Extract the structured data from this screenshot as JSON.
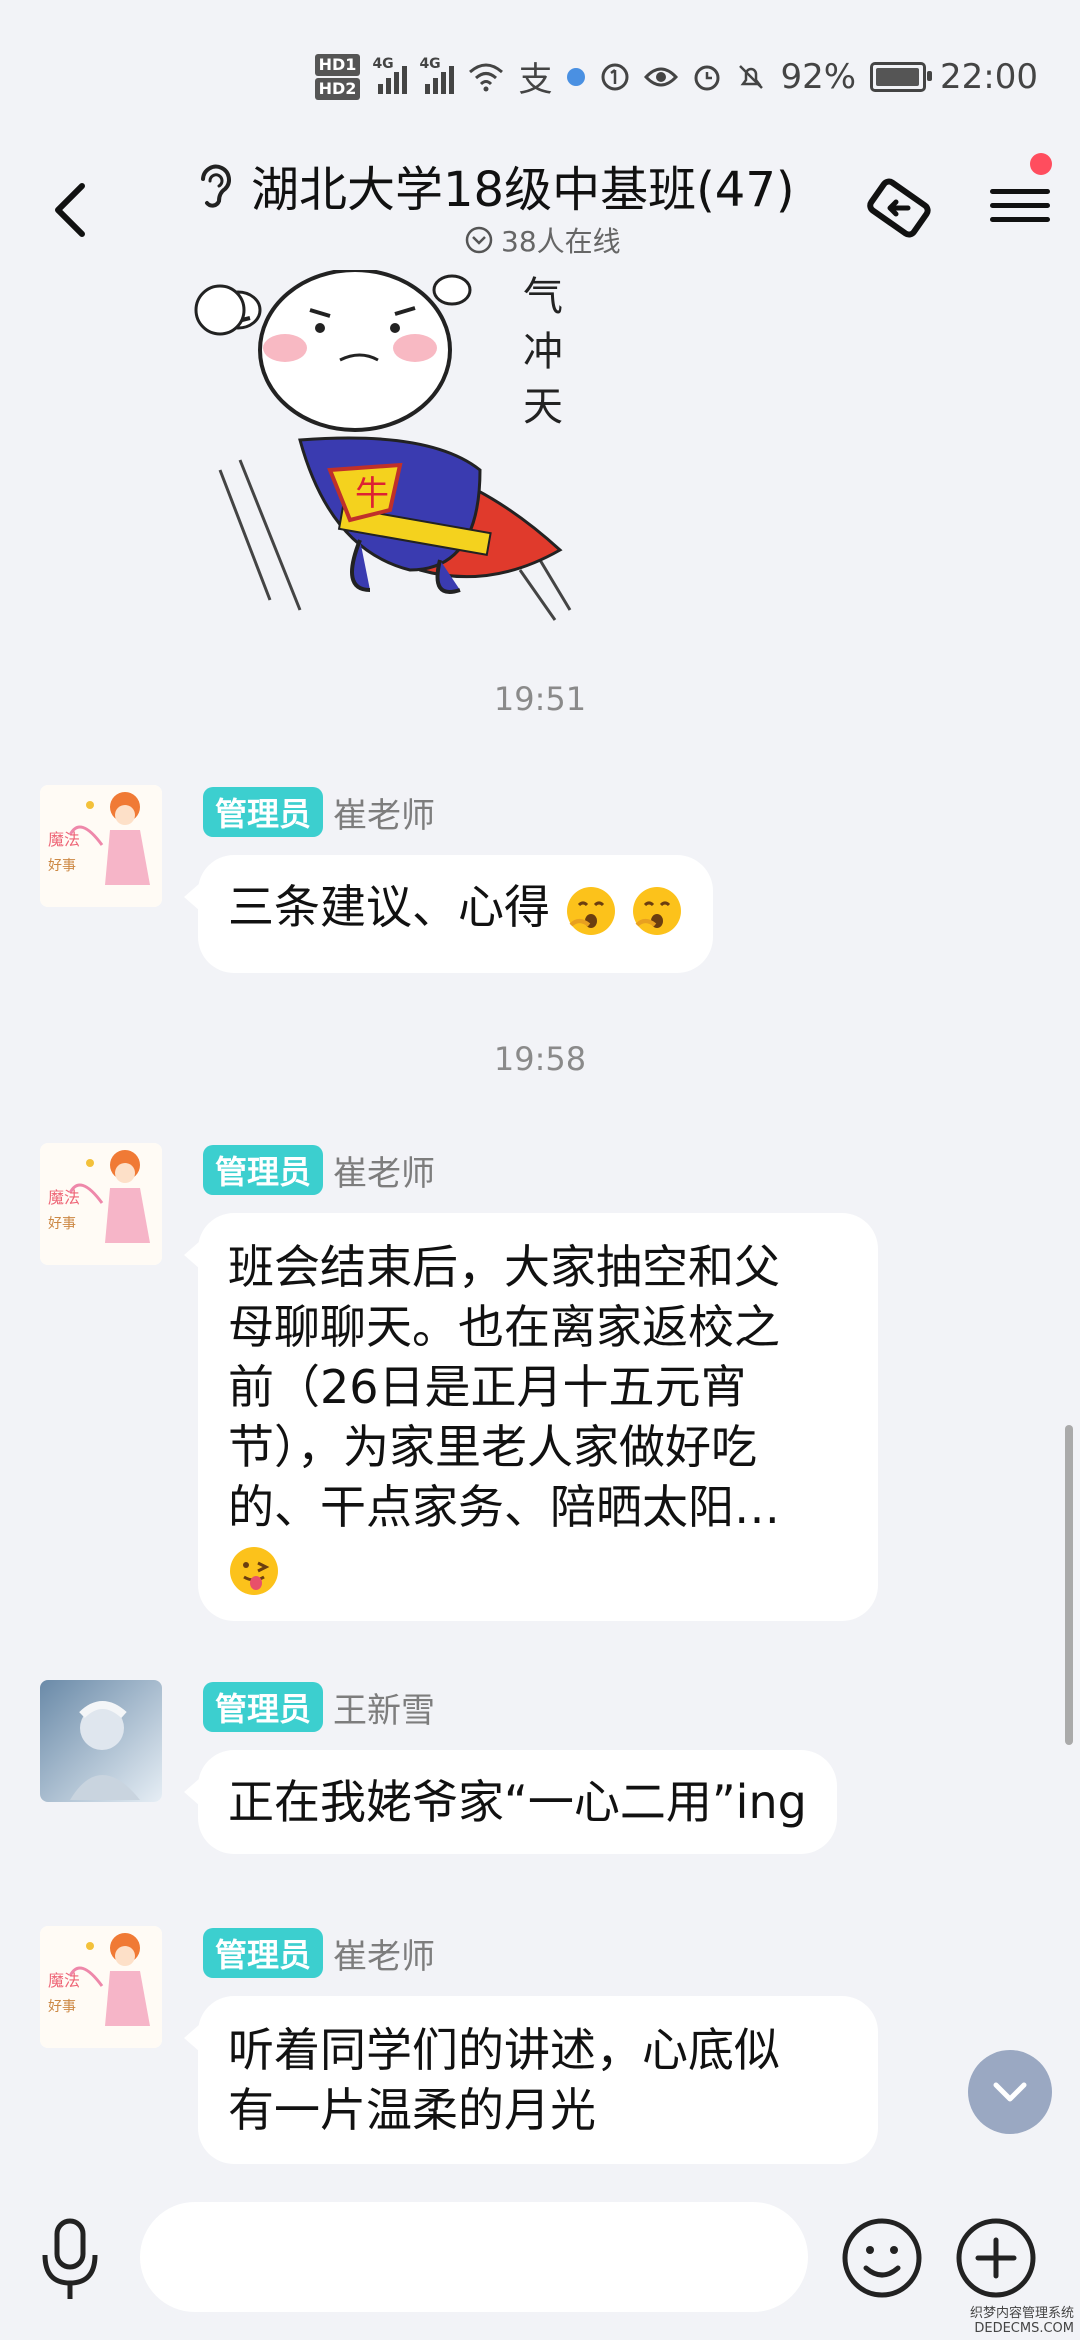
{
  "status_bar": {
    "sim1": "HD1",
    "sim2": "HD2",
    "net1": "4G",
    "net2": "4G",
    "pay": "支",
    "battery": "92%",
    "time": "22:00"
  },
  "header": {
    "title": "湖北大学18级中基班(47)",
    "online": "38人在线",
    "ear_icon": "ear-icon",
    "share_icon": "share-icon",
    "menu_icon": "menu-icon"
  },
  "sticker": {
    "texts": [
      "气",
      "冲",
      "天"
    ],
    "badge": "牛"
  },
  "messages": [
    {
      "time": "19:51",
      "badge": "管理员",
      "sender": "崔老师",
      "text": "三条建议、心得"
    },
    {
      "time": "19:58",
      "badge": "管理员",
      "sender": "崔老师",
      "lines": [
        "班会结束后，大家抽空和父",
        "母聊聊天。也在离家返校之",
        "前（26日是正月十五元宵",
        "节），为家里老人家做好吃",
        "的、干点家务、陪晒太阳…"
      ]
    },
    {
      "badge": "管理员",
      "sender": "王新雪",
      "text": "正在我姥爷家“一心二用”ing"
    },
    {
      "badge": "管理员",
      "sender": "崔老师",
      "lines": [
        "听着同学们的讲述，心底似",
        "有一片温柔的月光"
      ]
    }
  ],
  "input": {
    "placeholder": ""
  },
  "watermark": {
    "line1": "织梦内容管理系统",
    "line2": "DEDECMS.COM"
  }
}
